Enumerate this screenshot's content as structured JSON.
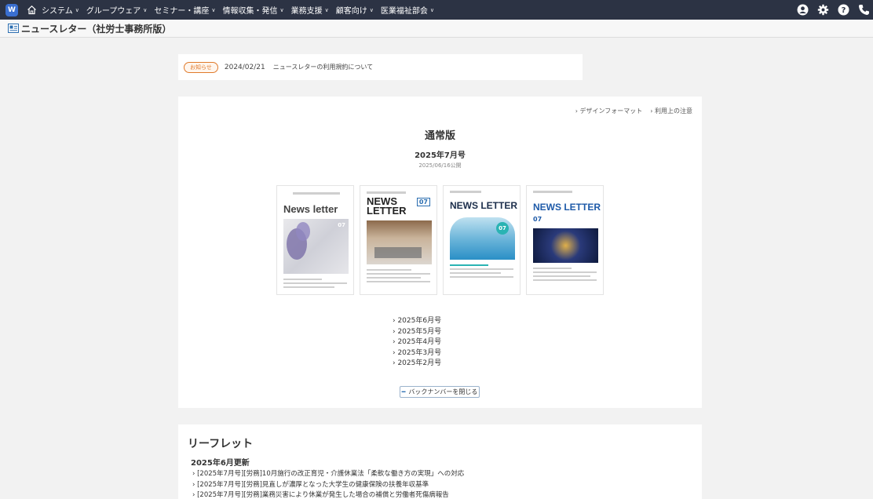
{
  "nav": {
    "logo_text": "W",
    "items": [
      {
        "label": "システム"
      },
      {
        "label": "グループウェア"
      },
      {
        "label": "セミナー・講座"
      },
      {
        "label": "情報収集・発信"
      },
      {
        "label": "業務支援"
      },
      {
        "label": "顧客向け"
      },
      {
        "label": "医業福祉部会"
      }
    ],
    "right_icons": [
      "user-icon",
      "gear-icon",
      "help-icon",
      "phone-icon"
    ]
  },
  "page": {
    "title": "ニュースレター（社労士事務所版）"
  },
  "notice": {
    "badge": "お知らせ",
    "date": "2024/02/21",
    "title": "ニュースレターの利用規約について"
  },
  "main": {
    "links": [
      "› デザインフォーマット",
      "› 利用上の注意"
    ],
    "title": "通常版",
    "issue": "2025年7月号",
    "published": "2025/06/16公開",
    "covers": [
      {
        "title": "News letter",
        "badge": "07"
      },
      {
        "title": "NEWS LETTER",
        "badge": "07"
      },
      {
        "title": "NEWS LETTER",
        "badge": "07"
      },
      {
        "title": "NEWS LETTER",
        "badge": "07"
      }
    ],
    "back_numbers": [
      "› 2025年6月号",
      "› 2025年5月号",
      "› 2025年4月号",
      "› 2025年3月号",
      "› 2025年2月号"
    ],
    "close_button": "バックナンバーを閉じる"
  },
  "leaflet": {
    "title": "リーフレット",
    "subtitle": "2025年6月更新",
    "items": [
      "› [2025年7月号][労務]10月施行の改正育児・介護休業法「柔軟な働き方の実現」への対応",
      "› [2025年7月号][労務]見直しが濃厚となった大学生の健康保険の扶養年収基準",
      "› [2025年7月号][労務]業務災害により休業が発生した場合の補償と労働者死傷病報告"
    ]
  },
  "colors": {
    "nav_bg": "#2c3344",
    "accent": "#e07a2b",
    "link_blue": "#2a6db0"
  }
}
